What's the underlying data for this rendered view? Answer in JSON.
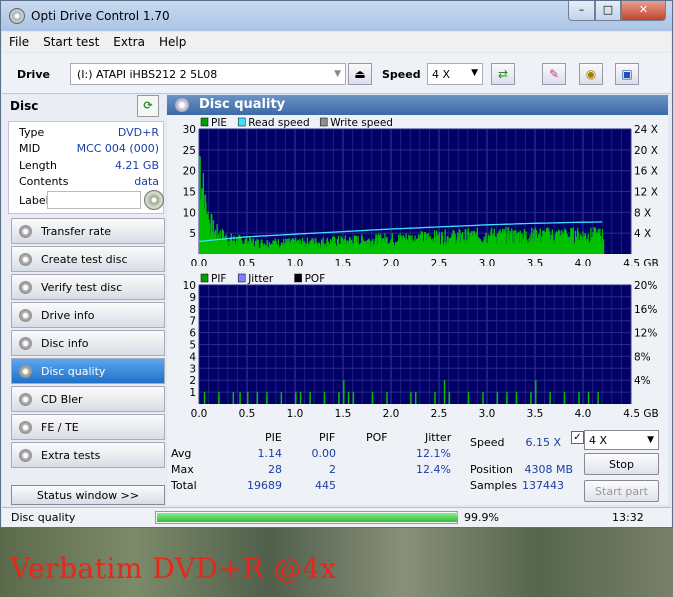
{
  "app": {
    "title": "Opti Drive Control 1.70"
  },
  "window_controls": {
    "minimize": "–",
    "maximize": "□",
    "close": "✕"
  },
  "menu": [
    "File",
    "Start test",
    "Extra",
    "Help"
  ],
  "toolbar": {
    "drive_label": "Drive",
    "drive_value": "(I:)   ATAPI iHBS212   2 5L08",
    "speed_label": "Speed",
    "speed_value": "4 X",
    "icons": [
      "eject-icon",
      "swap-icon",
      "eraser-icon",
      "recorder-icon",
      "save-icon"
    ]
  },
  "disc": {
    "heading": "Disc",
    "rows": [
      {
        "label": "Type",
        "value": "DVD+R"
      },
      {
        "label": "MID",
        "value": "MCC 004 (000)"
      },
      {
        "label": "Length",
        "value": "4.21 GB"
      },
      {
        "label": "Contents",
        "value": "data"
      },
      {
        "label": "Label",
        "value": ""
      }
    ]
  },
  "nav": [
    {
      "label": "Transfer rate",
      "active": false
    },
    {
      "label": "Create test disc",
      "active": false
    },
    {
      "label": "Verify test disc",
      "active": false
    },
    {
      "label": "Drive info",
      "active": false
    },
    {
      "label": "Disc info",
      "active": false
    },
    {
      "label": "Disc quality",
      "active": true
    },
    {
      "label": "CD Bler",
      "active": false
    },
    {
      "label": "FE / TE",
      "active": false
    },
    {
      "label": "Extra tests",
      "active": false
    }
  ],
  "status_window_label": "Status window >>",
  "panel_title": "Disc quality",
  "chart_data": [
    {
      "type": "bar",
      "legend": [
        "PIE",
        "Read speed",
        "Write speed"
      ],
      "legend_colors": [
        "#00a000",
        "#40e0ff",
        "#909090"
      ],
      "x_ticks": [
        "0.0",
        "0.5",
        "1.0",
        "1.5",
        "2.0",
        "2.5",
        "3.0",
        "3.5",
        "4.0",
        "4.5 GB"
      ],
      "xlim": [
        0,
        4.5
      ],
      "y_left_ticks": [
        "30",
        "25",
        "20",
        "15",
        "10",
        "5"
      ],
      "ylim_left": [
        0,
        30
      ],
      "y_right_ticks": [
        "24 X",
        "20 X",
        "16 X",
        "12 X",
        "8 X",
        "4 X"
      ],
      "ylim_right": [
        0,
        24
      ],
      "pie_profile": {
        "x": [
          0.0,
          0.02,
          0.05,
          0.1,
          0.15,
          0.3,
          0.6,
          1.0,
          1.5,
          2.0,
          2.5,
          3.0,
          3.5,
          4.0,
          4.21
        ],
        "y": [
          28,
          20,
          14,
          9,
          6,
          4,
          3,
          3,
          3.5,
          4,
          4.5,
          5,
          5,
          5,
          5
        ]
      },
      "read_speed": {
        "x": [
          0.0,
          0.1,
          0.5,
          1.0,
          1.5,
          2.0,
          2.5,
          3.0,
          3.5,
          4.0,
          4.21
        ],
        "y": [
          2.4,
          2.6,
          3.3,
          3.8,
          4.3,
          4.8,
          5.2,
          5.6,
          5.9,
          6.1,
          6.15
        ]
      },
      "grid": true,
      "background": "#000066"
    },
    {
      "type": "bar",
      "legend": [
        "PIF",
        "Jitter",
        "POF"
      ],
      "legend_colors": [
        "#00a000",
        "#8080ff",
        "#000000"
      ],
      "x_ticks": [
        "0.0",
        "0.5",
        "1.0",
        "1.5",
        "2.0",
        "2.5",
        "3.0",
        "3.5",
        "4.0",
        "4.5 GB"
      ],
      "xlim": [
        0,
        4.5
      ],
      "y_left_ticks": [
        "10",
        "9",
        "8",
        "7",
        "6",
        "5",
        "4",
        "3",
        "2",
        "1"
      ],
      "ylim_left": [
        0,
        10
      ],
      "y_right_ticks": [
        "20%",
        "16%",
        "12%",
        "8%",
        "4%"
      ],
      "ylim_right": [
        0,
        20
      ],
      "pif_spikes": {
        "x": [
          0.05,
          0.2,
          0.35,
          0.42,
          0.5,
          0.6,
          0.7,
          0.85,
          1.0,
          1.05,
          1.15,
          1.3,
          1.45,
          1.5,
          1.55,
          1.6,
          1.8,
          1.95,
          2.2,
          2.25,
          2.45,
          2.55,
          2.6,
          2.8,
          2.95,
          3.1,
          3.2,
          3.3,
          3.45,
          3.5,
          3.65,
          3.8,
          3.95,
          4.05,
          4.15
        ],
        "y": [
          1,
          1,
          1,
          1,
          1,
          1,
          1,
          1,
          1,
          1,
          1,
          1,
          1,
          2,
          1,
          1,
          1,
          1,
          1,
          1,
          1,
          2,
          1,
          1,
          1,
          1,
          1,
          1,
          1,
          2,
          1,
          1,
          1,
          1,
          1
        ]
      },
      "jitter": {
        "x": [
          0.0,
          0.5,
          1.0,
          1.5,
          2.0,
          2.5,
          3.0,
          3.5,
          4.0,
          4.21
        ],
        "y": [
          11.8,
          12.0,
          12.1,
          12.1,
          12.2,
          12.1,
          12.2,
          12.3,
          12.3,
          12.4
        ]
      },
      "grid": true,
      "background": "#000066"
    }
  ],
  "stats": {
    "headers": [
      "PIE",
      "PIF",
      "POF",
      "Jitter"
    ],
    "jitter_checked": true,
    "rows": [
      {
        "label": "Avg",
        "pie": "1.14",
        "pif": "0.00",
        "pof": "",
        "jitter": "12.1%"
      },
      {
        "label": "Max",
        "pie": "28",
        "pif": "2",
        "pof": "",
        "jitter": "12.4%"
      },
      {
        "label": "Total",
        "pie": "19689",
        "pif": "445",
        "pof": "",
        "jitter": ""
      }
    ],
    "speed_label": "Speed",
    "speed_value": "6.15 X",
    "position_label": "Position",
    "position_value": "4308 MB",
    "samples_label": "Samples",
    "samples_value": "137443",
    "speed_select": "4 X",
    "stop_label": "Stop",
    "start_part_label": "Start part"
  },
  "statusbar": {
    "text": "Disc quality",
    "progress": 0.999,
    "percent": "99.9%",
    "time": "13:32"
  },
  "overlay_caption": "Verbatim DVD+R @4x"
}
